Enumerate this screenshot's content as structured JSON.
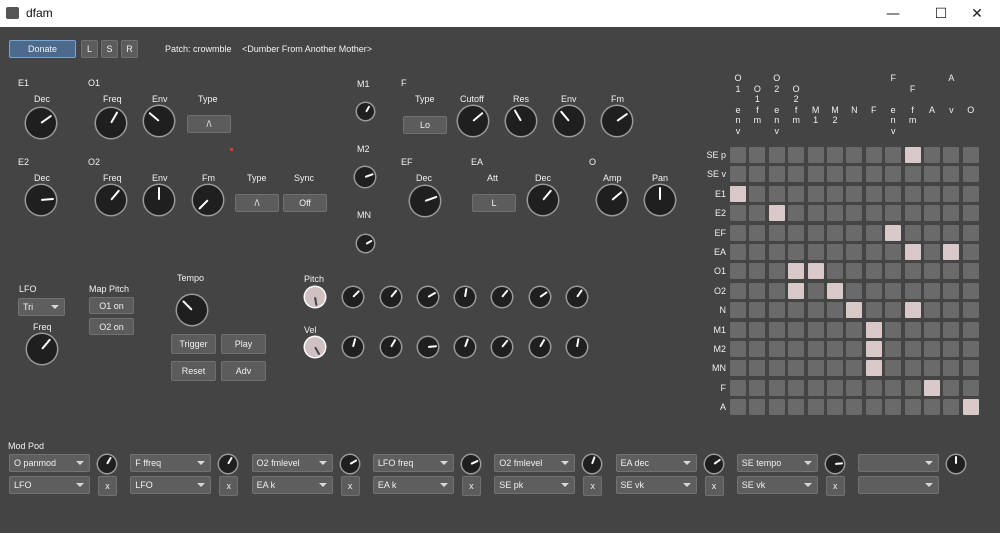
{
  "window": {
    "title": "dfam",
    "minimize": "—",
    "maximize": "☐",
    "close": "✕"
  },
  "toolbar": {
    "donate": "Donate",
    "l": "L",
    "s": "S",
    "r": "R",
    "patch": "Patch: crowmble",
    "patch_desc": "<Dumber From Another Mother>"
  },
  "e1": {
    "title": "E1",
    "dec": "Dec"
  },
  "o1": {
    "title": "O1",
    "freq": "Freq",
    "env": "Env",
    "type": "Type",
    "type_value": "/\\"
  },
  "e2": {
    "title": "E2",
    "dec": "Dec"
  },
  "o2": {
    "title": "O2",
    "freq": "Freq",
    "env": "Env",
    "fm": "Fm",
    "type": "Type",
    "sync": "Sync",
    "type_value": "/\\",
    "sync_value": "Off"
  },
  "m": {
    "m1": "M1",
    "m2": "M2",
    "mn": "MN"
  },
  "f": {
    "title": "F",
    "type": "Type",
    "cutoff": "Cutoff",
    "res": "Res",
    "env": "Env",
    "fm": "Fm",
    "type_value": "Lo"
  },
  "ef": {
    "title": "EF",
    "dec": "Dec"
  },
  "ea": {
    "title": "EA",
    "att": "Att",
    "dec": "Dec",
    "att_value": "L"
  },
  "o": {
    "title": "O",
    "amp": "Amp",
    "pan": "Pan"
  },
  "lfo": {
    "title": "LFO",
    "wave": "Tri",
    "freq": "Freq"
  },
  "mappitch": {
    "title": "Map Pitch",
    "o1": "O1 on",
    "o2": "O2 on"
  },
  "tempo": {
    "title": "Tempo",
    "trigger": "Trigger",
    "play": "Play",
    "reset": "Reset",
    "adv": "Adv"
  },
  "seq": {
    "pitch": "Pitch",
    "vel": "Vel"
  },
  "matrix": {
    "rows": [
      "SE p",
      "SE v",
      "E1",
      "E2",
      "EF",
      "EA",
      "O1",
      "O2",
      "N",
      "M1",
      "M2",
      "MN",
      "F",
      "A"
    ],
    "cols": [
      [
        "",
        "e",
        "v"
      ],
      [
        "O",
        "n",
        "v"
      ],
      [
        "1",
        "f",
        ""
      ],
      [
        "",
        "m",
        ""
      ],
      [
        "O",
        "e",
        "v"
      ],
      [
        "2",
        "n",
        "v"
      ],
      [
        "",
        "f",
        ""
      ],
      [
        "O",
        "m",
        ""
      ],
      [
        "2",
        "M",
        "1"
      ],
      [
        "",
        "M",
        "2"
      ],
      [
        "",
        "N",
        ""
      ],
      [
        "",
        "F",
        ""
      ],
      [
        "F",
        "e",
        "v"
      ],
      [
        "",
        "f",
        "m"
      ],
      [
        "",
        "A",
        ""
      ],
      [
        "A",
        "v",
        ""
      ],
      [
        "",
        "O",
        ""
      ]
    ],
    "colhead": [
      "O",
      "1",
      "",
      "O",
      "2",
      "",
      "O",
      "2",
      "",
      "",
      "",
      "",
      "F",
      "F",
      "",
      "A",
      ""
    ],
    "colsub": [
      "e",
      "f",
      "e",
      "f",
      "M",
      "M",
      "N",
      "F",
      "e",
      "f",
      "A",
      "v",
      "O"
    ],
    "on": [
      [
        0,
        9
      ],
      [
        2,
        0
      ],
      [
        3,
        2
      ],
      [
        4,
        8
      ],
      [
        5,
        9
      ],
      [
        5,
        11
      ],
      [
        6,
        3
      ],
      [
        6,
        4
      ],
      [
        7,
        3
      ],
      [
        7,
        5
      ],
      [
        8,
        6
      ],
      [
        8,
        9
      ],
      [
        9,
        7
      ],
      [
        10,
        7
      ],
      [
        11,
        7
      ],
      [
        12,
        10
      ],
      [
        13,
        12
      ]
    ]
  },
  "modpod": {
    "title": "Mod Pod",
    "slots": [
      {
        "src": "O panmod",
        "dst": "LFO",
        "x": "x"
      },
      {
        "src": "F ffreq",
        "dst": "LFO",
        "x": "x"
      },
      {
        "src": "O2 fmlevel",
        "dst": "EA k",
        "x": "x"
      },
      {
        "src": "LFO freq",
        "dst": "EA k",
        "x": "x"
      },
      {
        "src": "O2 fmlevel",
        "dst": "SE pk",
        "x": "x"
      },
      {
        "src": "EA dec",
        "dst": "SE vk",
        "x": "x"
      },
      {
        "src": "SE tempo",
        "dst": "SE vk",
        "x": "x"
      },
      {
        "src": "",
        "dst": "",
        "x": ""
      }
    ]
  }
}
